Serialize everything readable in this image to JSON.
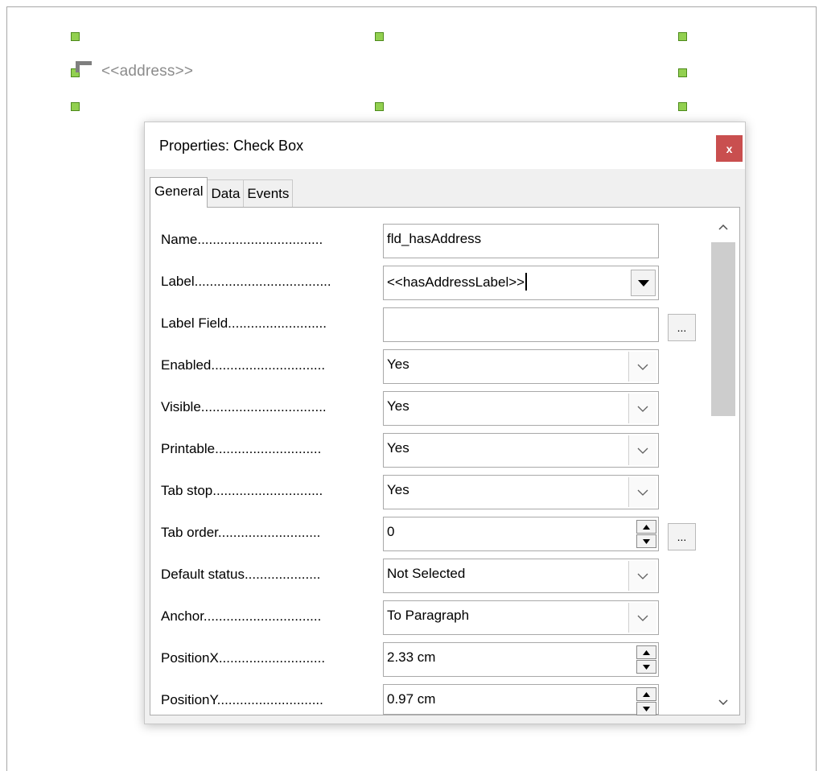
{
  "document": {
    "address_field": "<<address>>"
  },
  "dialog": {
    "title": "Properties: Check Box",
    "close_label": "x",
    "tabs": [
      "General",
      "Data",
      "Events"
    ],
    "active_tab": "General",
    "rows": [
      {
        "label": "Name.................................",
        "value": "fld_hasAddress",
        "control": "text"
      },
      {
        "label": "Label....................................",
        "value": "<<hasAddressLabel>>",
        "control": "combo-edit"
      },
      {
        "label": "Label Field..........................",
        "value": "",
        "control": "text-button",
        "button": "..."
      },
      {
        "label": "Enabled..............................",
        "value": "Yes",
        "control": "select"
      },
      {
        "label": "Visible.................................",
        "value": "Yes",
        "control": "select"
      },
      {
        "label": "Printable............................",
        "value": "Yes",
        "control": "select"
      },
      {
        "label": "Tab stop.............................",
        "value": "Yes",
        "control": "select"
      },
      {
        "label": "Tab order...........................",
        "value": "0",
        "control": "spin-button",
        "button": "..."
      },
      {
        "label": "Default status....................",
        "value": "Not Selected",
        "control": "select"
      },
      {
        "label": "Anchor...............................",
        "value": "To Paragraph",
        "control": "select"
      },
      {
        "label": "PositionX............................",
        "value": "2.33 cm",
        "control": "spin"
      },
      {
        "label": "PositionY............................",
        "value": "0.97 cm",
        "control": "spin"
      }
    ]
  },
  "colors": {
    "handle_fill": "#92d050",
    "close_button": "#c94f4f",
    "dialog_bg": "#f0f0f0"
  },
  "icons": [
    "selection-handle",
    "text-anchor-mark",
    "close-icon",
    "dropdown-arrow-icon",
    "spin-up-icon",
    "spin-down-icon",
    "scroll-up-icon",
    "scroll-down-icon"
  ]
}
